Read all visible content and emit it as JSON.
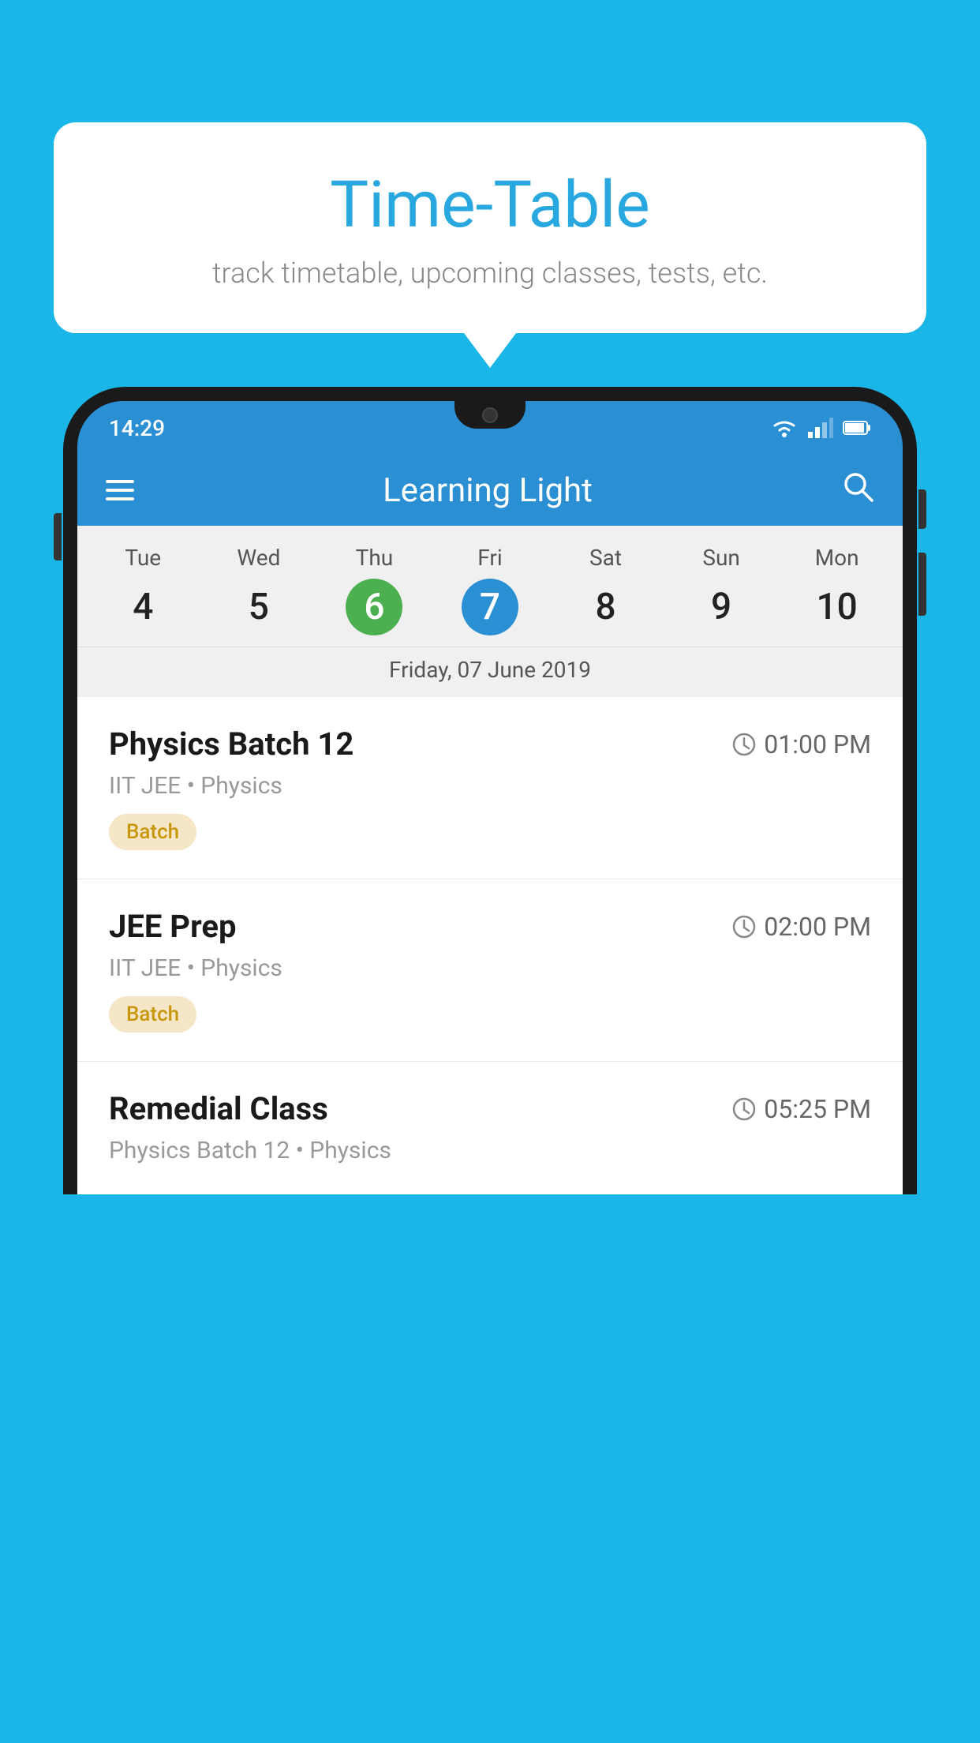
{
  "background_color": "#1ab6e8",
  "speech_bubble": {
    "title": "Time-Table",
    "subtitle": "track timetable, upcoming classes, tests, etc."
  },
  "phone": {
    "status_bar": {
      "time": "14:29"
    },
    "app_header": {
      "title": "Learning Light"
    },
    "calendar": {
      "days": [
        {
          "label": "Tue",
          "num": "4",
          "state": "normal"
        },
        {
          "label": "Wed",
          "num": "5",
          "state": "normal"
        },
        {
          "label": "Thu",
          "num": "6",
          "state": "today"
        },
        {
          "label": "Fri",
          "num": "7",
          "state": "selected"
        },
        {
          "label": "Sat",
          "num": "8",
          "state": "normal"
        },
        {
          "label": "Sun",
          "num": "9",
          "state": "normal"
        },
        {
          "label": "Mon",
          "num": "10",
          "state": "normal"
        }
      ],
      "selected_date_label": "Friday, 07 June 2019"
    },
    "schedule": [
      {
        "title": "Physics Batch 12",
        "time": "01:00 PM",
        "sub": "IIT JEE • Physics",
        "badge": "Batch"
      },
      {
        "title": "JEE Prep",
        "time": "02:00 PM",
        "sub": "IIT JEE • Physics",
        "badge": "Batch"
      },
      {
        "title": "Remedial Class",
        "time": "05:25 PM",
        "sub": "Physics Batch 12 • Physics",
        "badge": null
      }
    ]
  }
}
